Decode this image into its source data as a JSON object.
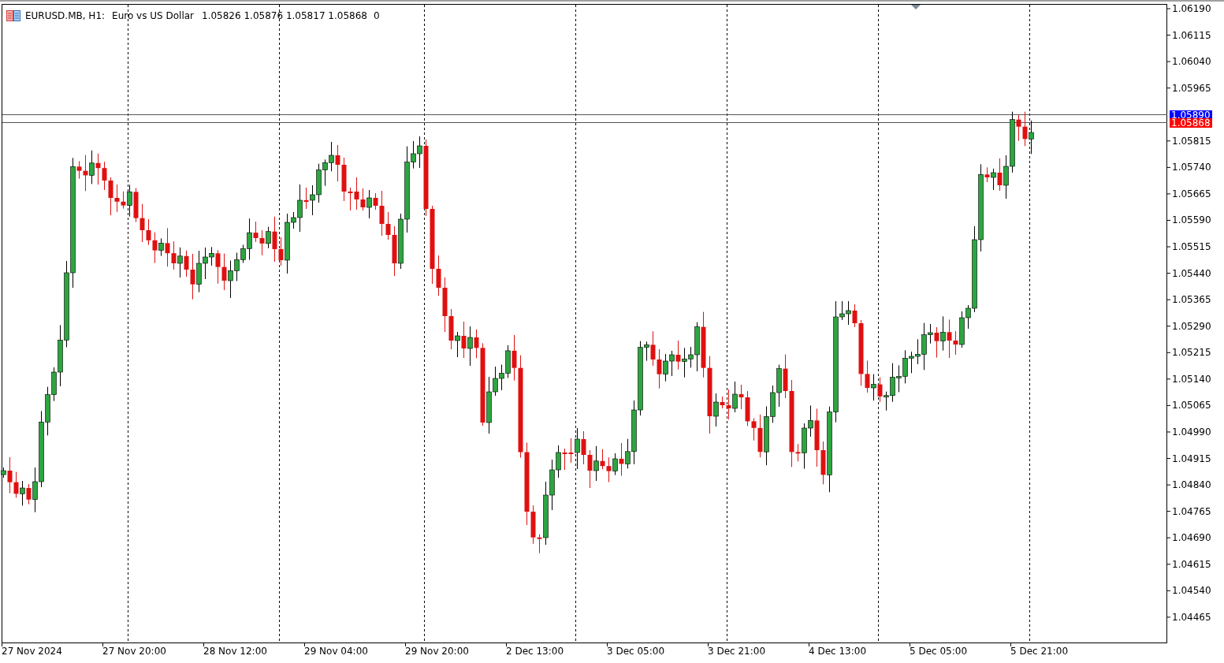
{
  "chart_header": {
    "symbol": "EURUSD.MB, H1:",
    "description": "Euro vs US Dollar",
    "ohlc": "1.05826 1.05876 1.05817 1.05868",
    "volume": "0"
  },
  "price_axis": [
    "1.06190",
    "1.06115",
    "1.06040",
    "1.05965",
    "1.05815",
    "1.05740",
    "1.05665",
    "1.05590",
    "1.05515",
    "1.05440",
    "1.05365",
    "1.05290",
    "1.05215",
    "1.05140",
    "1.05065",
    "1.04990",
    "1.04915",
    "1.04840",
    "1.04765",
    "1.04690",
    "1.04615",
    "1.04540",
    "1.04465"
  ],
  "price_markers": [
    {
      "kind": "ask",
      "label": "1.05890"
    },
    {
      "kind": "bid",
      "label": "1.05868"
    }
  ],
  "time_axis": [
    "27 Nov 2024",
    "27 Nov 20:00",
    "28 Nov 12:00",
    "29 Nov 04:00",
    "29 Nov 20:00",
    "2 Dec 13:00",
    "3 Dec 05:00",
    "3 Dec 21:00",
    "4 Dec 13:00",
    "5 Dec 05:00",
    "5 Dec 21:00"
  ]
}
